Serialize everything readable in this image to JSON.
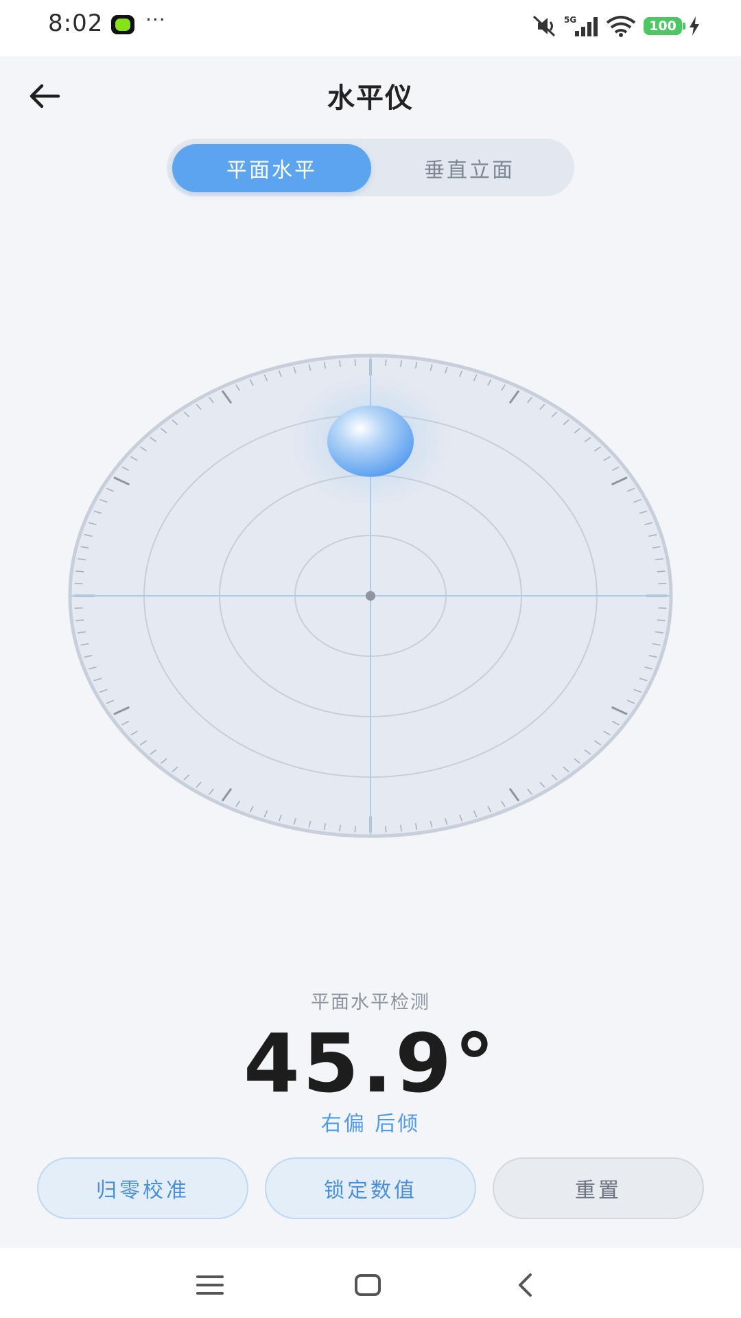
{
  "status_bar": {
    "time": "8:02",
    "dots": "···",
    "network": "5G",
    "battery": "100"
  },
  "header": {
    "title": "水平仪",
    "back_icon": "arrow-left-icon"
  },
  "tabs": [
    {
      "label": "平面水平",
      "active": true
    },
    {
      "label": "垂直立面",
      "active": false
    }
  ],
  "level": {
    "bubble_offset_x": 0,
    "bubble_offset_y": -0.64
  },
  "readout": {
    "mode_label": "平面水平检测",
    "angle": "45.9°",
    "direction": "右偏 后倾"
  },
  "actions": [
    {
      "label": "归零校准"
    },
    {
      "label": "锁定数值"
    },
    {
      "label": "重置"
    }
  ],
  "nav": {
    "icons": [
      "menu-icon",
      "home-icon",
      "back-icon"
    ]
  },
  "colors": {
    "accent": "#5DA4EE",
    "direction_text": "#4f9ae6",
    "background": "#F3F5F9"
  }
}
